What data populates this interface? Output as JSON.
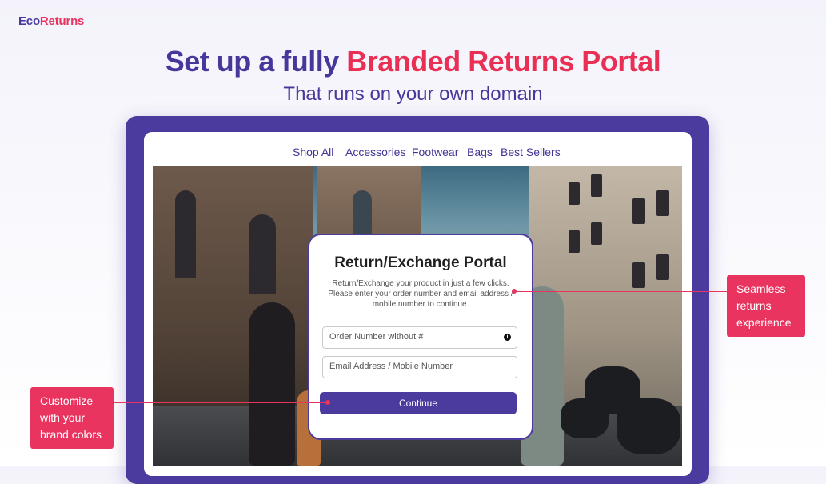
{
  "brand": {
    "name_part1": "Eco",
    "name_part2": "Returns"
  },
  "headline": {
    "part1": "Set up a fully ",
    "part2": "Branded Returns Portal"
  },
  "subheadline": "That runs on your own domain",
  "nav": {
    "items": [
      "Shop All",
      "Accessories",
      "Footwear",
      "Bags",
      "Best Sellers"
    ]
  },
  "portal": {
    "title": "Return/Exchange Portal",
    "description": "Return/Exchange your product in just a few clicks. Please enter your order number and email address / mobile number to continue.",
    "order_placeholder": "Order Number without #",
    "email_placeholder": "Email Address / Mobile Number",
    "continue_label": "Continue"
  },
  "callouts": {
    "right": [
      "Seamless",
      "returns",
      "experience"
    ],
    "left": [
      "Customize",
      "with your",
      "brand colors"
    ]
  },
  "colors": {
    "primary": "#4b3b9e",
    "accent": "#e8345e"
  }
}
